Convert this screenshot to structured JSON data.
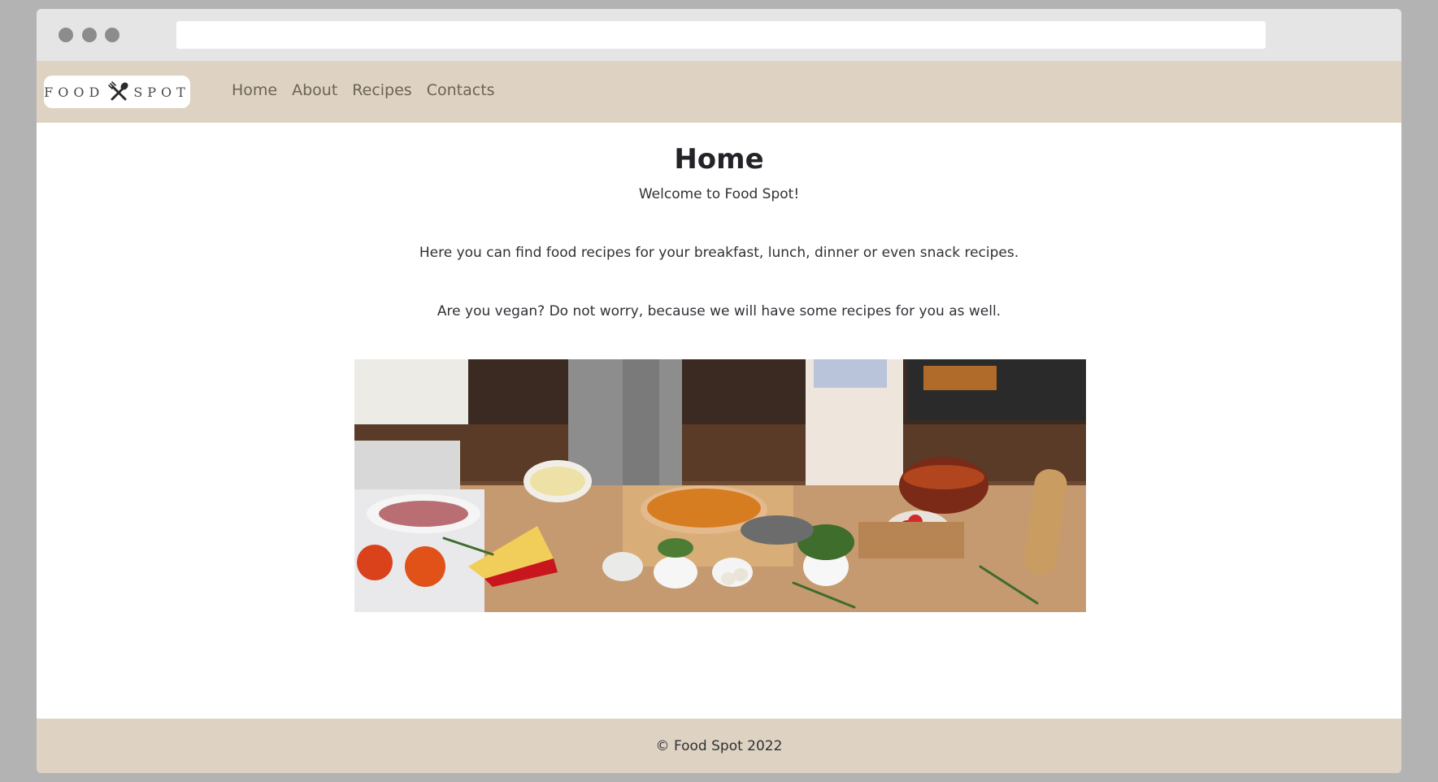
{
  "browser": {
    "address_value": ""
  },
  "navbar": {
    "logo_left": "FOOD",
    "logo_right": "SPOT",
    "logo_icon": "fork-knife-icon",
    "links": [
      {
        "label": "Home"
      },
      {
        "label": "About"
      },
      {
        "label": "Recipes"
      },
      {
        "label": "Contacts"
      }
    ]
  },
  "main": {
    "title": "Home",
    "welcome": "Welcome to Food Spot!",
    "paragraphs": [
      "Here you can find food recipes for your breakfast, lunch, dinner or even snack recipes.",
      "Are you vegan? Do not worry, because we will have some recipes for you as well."
    ],
    "hero_image": "kitchen-cooking-photo"
  },
  "footer": {
    "copyright": "© Food Spot 2022"
  },
  "colors": {
    "navbar_bg": "#ded3c2",
    "chrome_bg": "#e5e5e5",
    "page_bg": "#b3b3b3",
    "text": "#2f3136",
    "nav_text": "#6b6355"
  }
}
